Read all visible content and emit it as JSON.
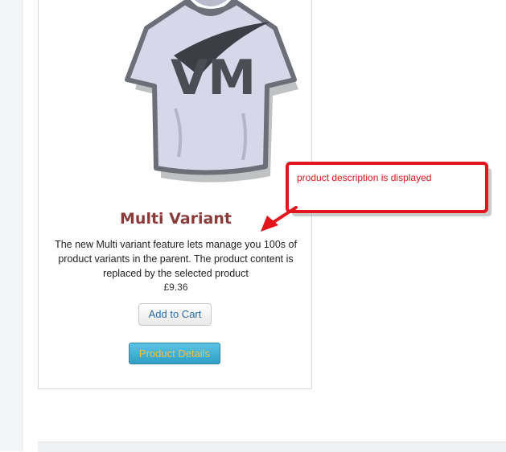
{
  "product": {
    "title": "Multi Variant",
    "description": "The new Multi variant feature lets manage you 100s of product variants in the parent. The product content is replaced by the selected product",
    "price": "£9.36",
    "add_to_cart_label": "Add to Cart",
    "details_label": "Product Details",
    "image_logo_text": "VM"
  },
  "annotation": {
    "text": "product description is displayed",
    "color": "#d9141c"
  }
}
